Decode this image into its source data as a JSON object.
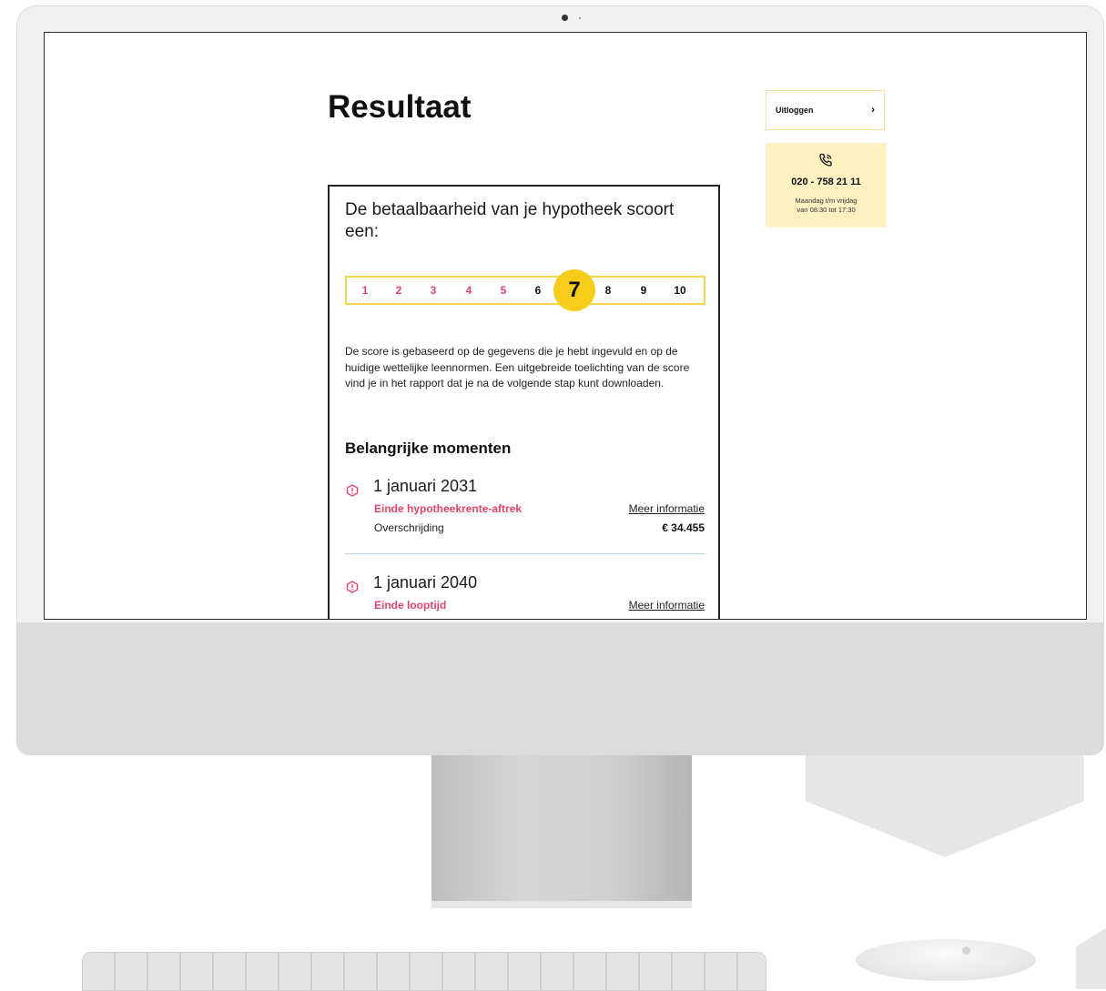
{
  "page": {
    "title": "Resultaat"
  },
  "result_card": {
    "heading": "De betaalbaarheid van je hypotheek scoort een:",
    "scale": {
      "numbers": [
        "1",
        "2",
        "3",
        "4",
        "5",
        "6",
        "7",
        "8",
        "9",
        "10"
      ],
      "selected": "7",
      "colors": {
        "low": "#e5426b",
        "high": "#111111",
        "highlight": "#f7cc1a",
        "border": "#f5d64a"
      }
    },
    "description": "De score is gebaseerd op de gegevens die je hebt ingevuld en op de huidige wettelijke leennormen. Een uitgebreide toelichting van de score vind je in het rapport dat je na de volgende stap kunt downloaden.",
    "moments_title": "Belangrijke momenten",
    "moments": [
      {
        "date": "1 januari 2031",
        "label": "Einde hypotheekrente-aftrek",
        "link": "Meer informatie",
        "key": "Overschrijding",
        "value": "€ 34.455",
        "icon": "alert-icon"
      },
      {
        "date": "1 januari 2040",
        "label": "Einde looptijd",
        "link": "Meer informatie",
        "icon": "alert-icon"
      }
    ]
  },
  "sidebar": {
    "logout_label": "Uitloggen",
    "logout_icon": "chevron-right-icon",
    "contact": {
      "icon": "phone-icon",
      "phone": "020 - 758 21 11",
      "hours_line1": "Maandag t/m vrijdag",
      "hours_line2": "van 08:30 tot 17:30"
    }
  },
  "colors": {
    "accent_yellow": "#f7cc1a",
    "accent_pink": "#e5426b",
    "contact_bg": "#fdf1c2"
  }
}
